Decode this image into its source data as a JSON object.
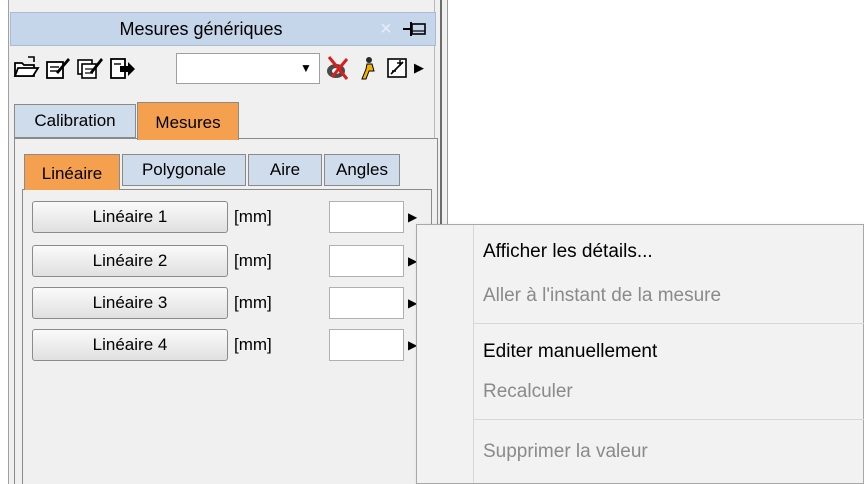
{
  "panel": {
    "title": "Mesures génériques",
    "close_glyph": "×",
    "toolbar": {
      "icons": [
        "open-folder-icon",
        "edit-icon",
        "edit-all-icon",
        "export-icon",
        "hide-icon",
        "run-icon",
        "add-measure-icon",
        "more-icon"
      ],
      "combo_value": "",
      "combo_arrow": "▼",
      "overflow_glyph": "▶"
    },
    "tabs": [
      "Calibration",
      "Mesures"
    ],
    "active_tab": "Mesures",
    "subtabs": [
      "Linéaire",
      "Polygonale",
      "Aire",
      "Angles"
    ],
    "active_subtab": "Linéaire",
    "rows": [
      {
        "label": "Linéaire 1",
        "unit": "[mm]",
        "value": ""
      },
      {
        "label": "Linéaire 2",
        "unit": "[mm]",
        "value": ""
      },
      {
        "label": "Linéaire 3",
        "unit": "[mm]",
        "value": ""
      },
      {
        "label": "Linéaire 4",
        "unit": "[mm]",
        "value": ""
      }
    ],
    "row_arrow": "▶"
  },
  "context_menu": {
    "items": [
      {
        "label": "Afficher les détails...",
        "enabled": true
      },
      {
        "label": "Aller à l'instant de la mesure",
        "enabled": false
      },
      {
        "label": "Editer manuellement",
        "enabled": true
      },
      {
        "label": "Recalculer",
        "enabled": false
      },
      {
        "label": "Supprimer la valeur",
        "enabled": false
      }
    ]
  },
  "colors": {
    "titlebar": "#c5d6ea",
    "active_tab": "#f5a04f",
    "inactive_tab": "#cfdcec",
    "menu_bg": "#f2f2f2",
    "disabled_text": "#8a8a8a"
  }
}
